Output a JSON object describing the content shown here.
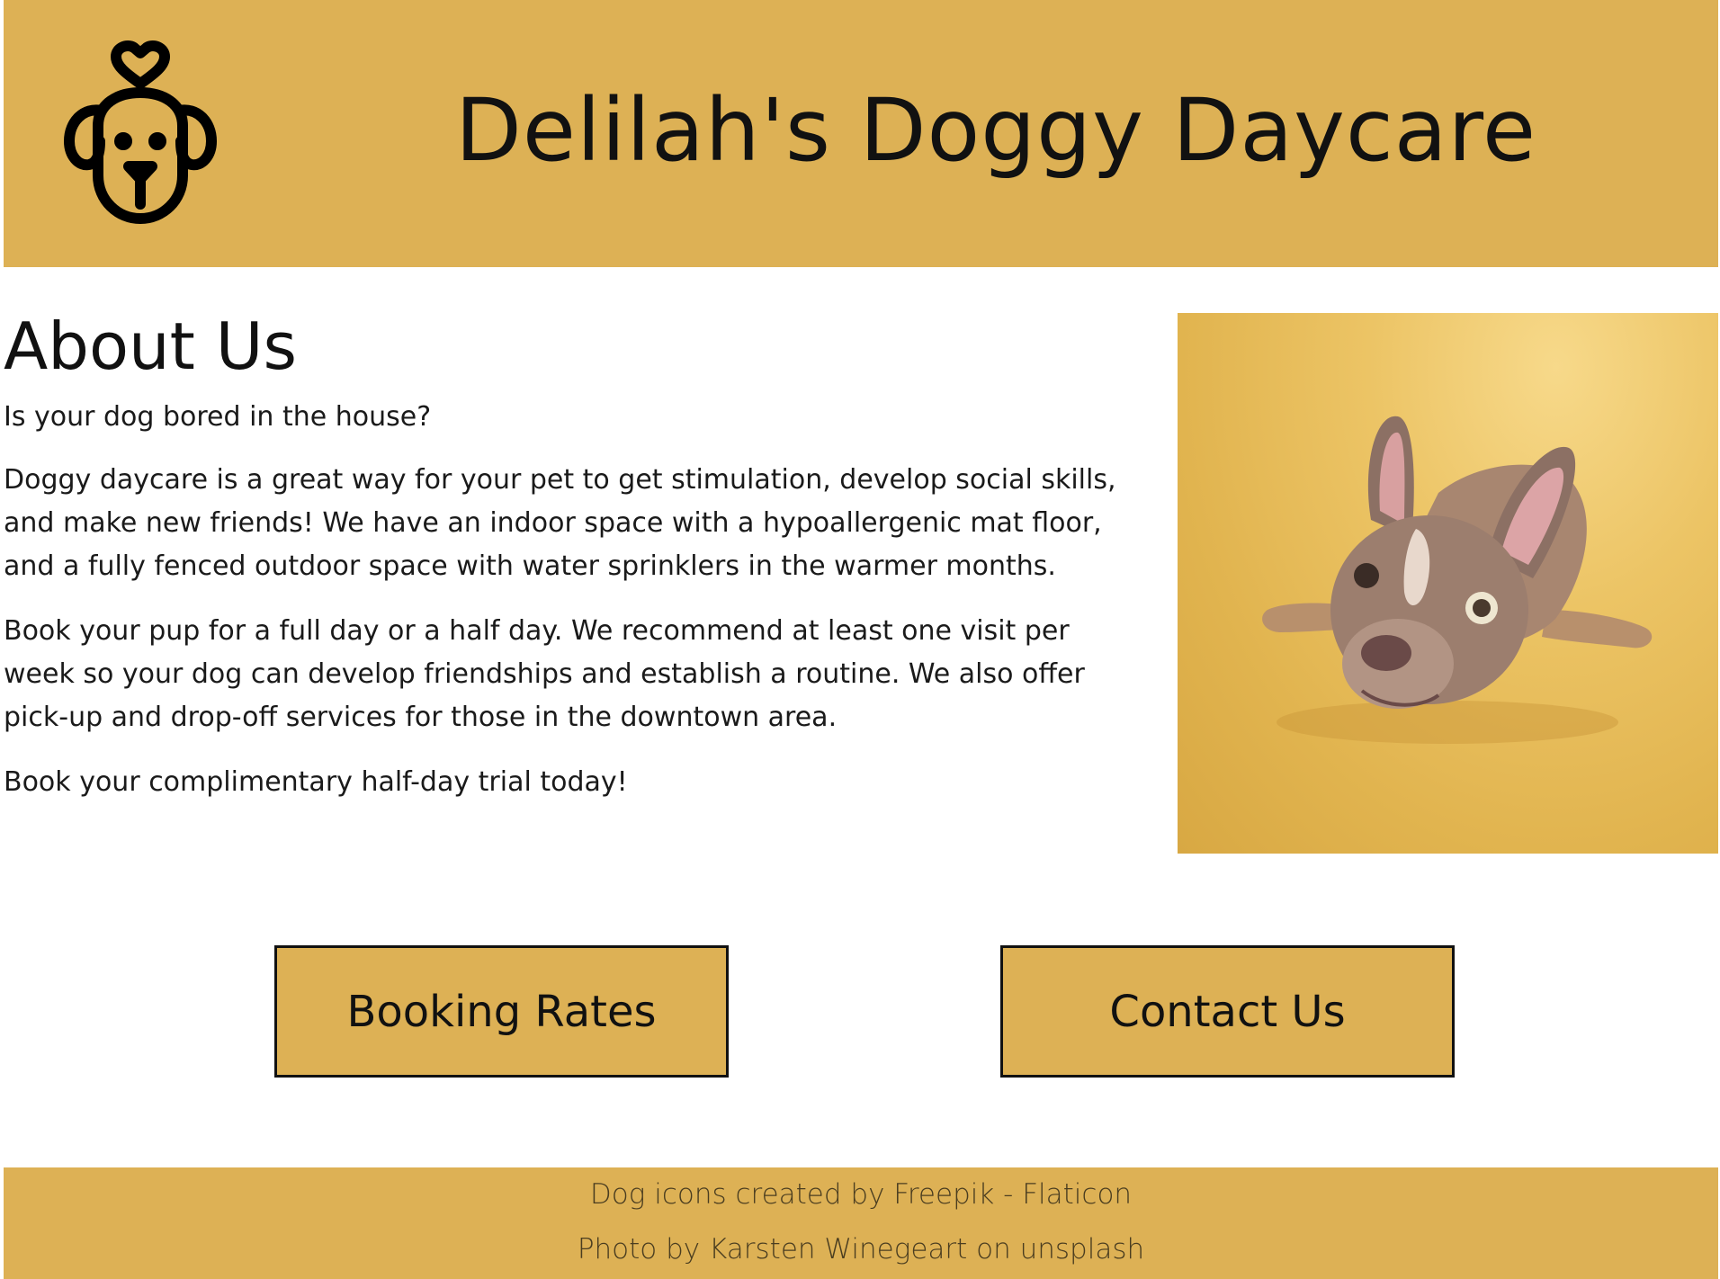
{
  "header": {
    "title": "Delilah's Doggy Daycare",
    "logo_icon": "dog-heart-icon"
  },
  "about": {
    "heading": "About Us",
    "paragraphs": [
      "Is your dog bored in the house?",
      "Doggy daycare is a great way for your pet to get stimulation, develop social skills, and make new friends! We have an indoor space with a hypoallergenic mat floor, and a fully fenced outdoor space with water sprinklers in the warmer months.",
      "Book your pup for a full day or a half day. We recommend at least one visit per week so your dog can develop friendships and establish a routine. We also offer pick-up and drop-off services for those in the downtown area.",
      "Book your complimentary half-day trial today!"
    ]
  },
  "buttons": {
    "rates_label": "Booking Rates",
    "contact_label": "Contact Us"
  },
  "footer": {
    "icons_credit": "Dog icons created by Freepik - Flaticon",
    "photo_credit": "Photo by Karsten Winegeart on unsplash"
  },
  "colors": {
    "accent": "#ddb155",
    "text": "#111111",
    "background": "#ffffff"
  }
}
